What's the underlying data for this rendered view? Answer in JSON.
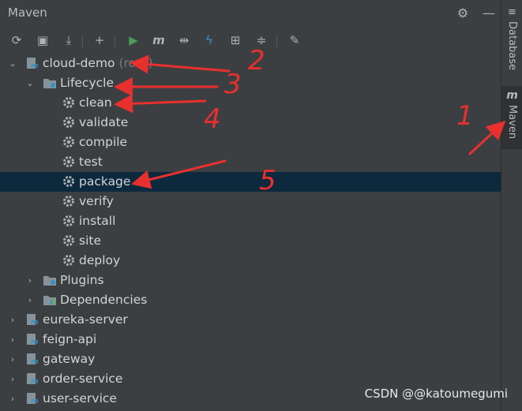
{
  "panel": {
    "title": "Maven"
  },
  "toolbar": {
    "items": [
      {
        "name": "reload-icon",
        "glyph": "⟳"
      },
      {
        "name": "generate-sources-icon",
        "glyph": "▣"
      },
      {
        "name": "download-icon",
        "glyph": "⤓"
      },
      {
        "name": "add-icon",
        "glyph": "+"
      },
      {
        "name": "run-icon",
        "glyph": "▶"
      },
      {
        "name": "execute-goal-icon",
        "glyph": "m"
      },
      {
        "name": "toggle-offline-icon",
        "glyph": "⇹"
      },
      {
        "name": "skip-tests-icon",
        "glyph": "ϟ"
      },
      {
        "name": "show-dependencies-icon",
        "glyph": "⊞"
      },
      {
        "name": "collapse-all-icon",
        "glyph": "≑"
      },
      {
        "name": "settings-wrench-icon",
        "glyph": "✎"
      }
    ]
  },
  "tree": [
    {
      "label": "cloud-demo",
      "suffix": "(root)",
      "type": "module",
      "expanded": true,
      "level": 0
    },
    {
      "label": "Lifecycle",
      "type": "folder",
      "expanded": true,
      "level": 1
    },
    {
      "label": "clean",
      "type": "goal",
      "level": 2
    },
    {
      "label": "validate",
      "type": "goal",
      "level": 2
    },
    {
      "label": "compile",
      "type": "goal",
      "level": 2
    },
    {
      "label": "test",
      "type": "goal",
      "level": 2
    },
    {
      "label": "package",
      "type": "goal",
      "level": 2,
      "selected": true
    },
    {
      "label": "verify",
      "type": "goal",
      "level": 2
    },
    {
      "label": "install",
      "type": "goal",
      "level": 2
    },
    {
      "label": "site",
      "type": "goal",
      "level": 2
    },
    {
      "label": "deploy",
      "type": "goal",
      "level": 2
    },
    {
      "label": "Plugins",
      "type": "plugins",
      "expanded": false,
      "level": 1
    },
    {
      "label": "Dependencies",
      "type": "deps",
      "expanded": false,
      "level": 1
    },
    {
      "label": "eureka-server",
      "type": "module",
      "expanded": false,
      "level": 0
    },
    {
      "label": "feign-api",
      "type": "module",
      "expanded": false,
      "level": 0
    },
    {
      "label": "gateway",
      "type": "module",
      "expanded": false,
      "level": 0
    },
    {
      "label": "order-service",
      "type": "module",
      "expanded": false,
      "level": 0
    },
    {
      "label": "user-service",
      "type": "module",
      "expanded": false,
      "level": 0
    }
  ],
  "sidebar": {
    "tabs": [
      {
        "label": "Database",
        "active": false
      },
      {
        "label": "Maven",
        "active": true
      }
    ]
  },
  "annotations": [
    "1",
    "2",
    "3",
    "4",
    "5"
  ],
  "watermark": "CSDN @@katoumegumi",
  "colors": {
    "accent_red": "#e8302f",
    "selection": "#0d293e",
    "run_green": "#499c54",
    "skip_blue": "#3592c4"
  }
}
